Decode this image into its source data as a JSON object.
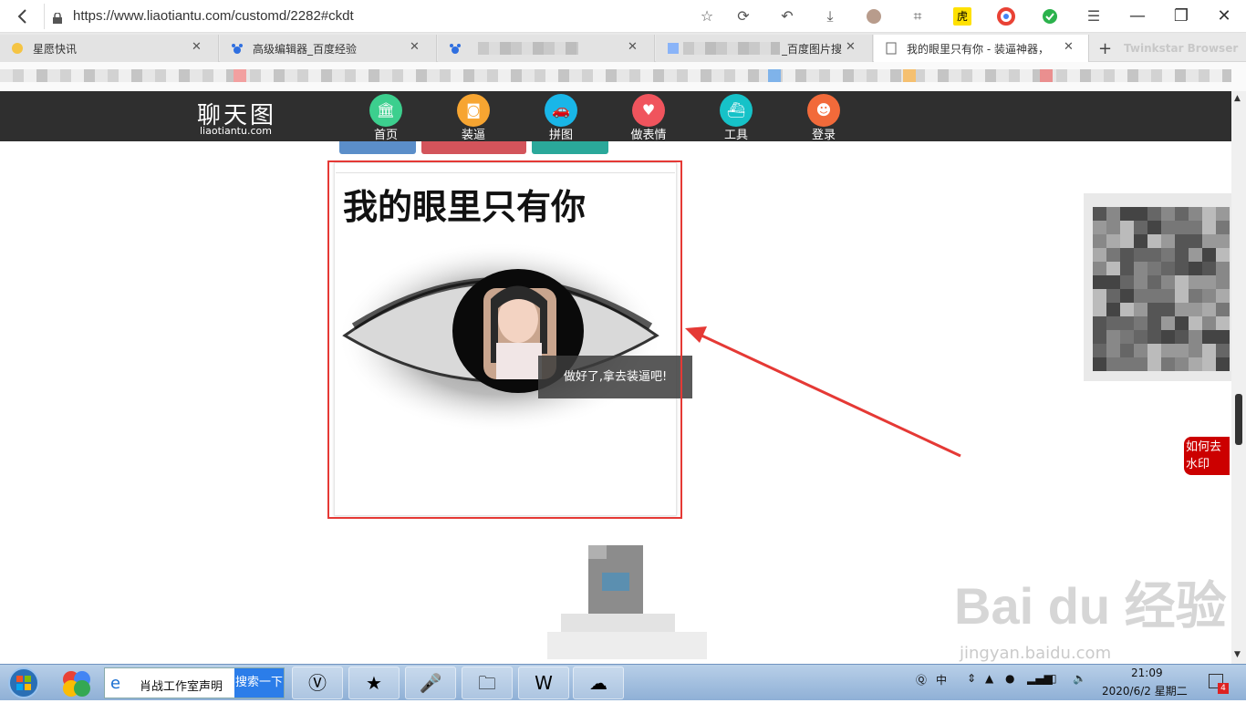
{
  "browser": {
    "url": "https://www.liaotiantu.com/customd/2282#ckdt",
    "tabs": [
      {
        "label": "星愿快讯"
      },
      {
        "label": "高级编辑器_百度经验"
      },
      {
        "label": ""
      },
      {
        "label": "_百度图片搜"
      },
      {
        "label": "我的眼里只有你 - 装逼神器，装"
      }
    ],
    "new_tab_label": "Twinkstar Browser",
    "tiger_label": "虎"
  },
  "site": {
    "logo_cn": "聊天图",
    "logo_en": "liaotiantu.com",
    "nav": [
      {
        "label": "首页",
        "color": "#3ccf8e"
      },
      {
        "label": "装逼",
        "color": "#f7a531"
      },
      {
        "label": "拼图",
        "color": "#19b6e8"
      },
      {
        "label": "做表情",
        "color": "#f0545d"
      },
      {
        "label": "工具",
        "color": "#16c2c8"
      },
      {
        "label": "登录",
        "color": "#f26a3a"
      }
    ]
  },
  "content": {
    "card_title": "我的眼里只有你",
    "tooltip": "做好了,拿去装逼吧!",
    "watermark_button": "如何去水印"
  },
  "watermark": {
    "brand": "Bai du 经验",
    "site": "jingyan.baidu.com"
  },
  "taskbar": {
    "search_value": "肖战工作室声明",
    "search_button": "搜索一下",
    "tray_lang": "中",
    "notif_count": "4",
    "time": "21:09",
    "date": "2020/6/2 星期二"
  },
  "colors": {
    "accent_red": "#e53935",
    "nav_bg": "#2f2f2f"
  }
}
